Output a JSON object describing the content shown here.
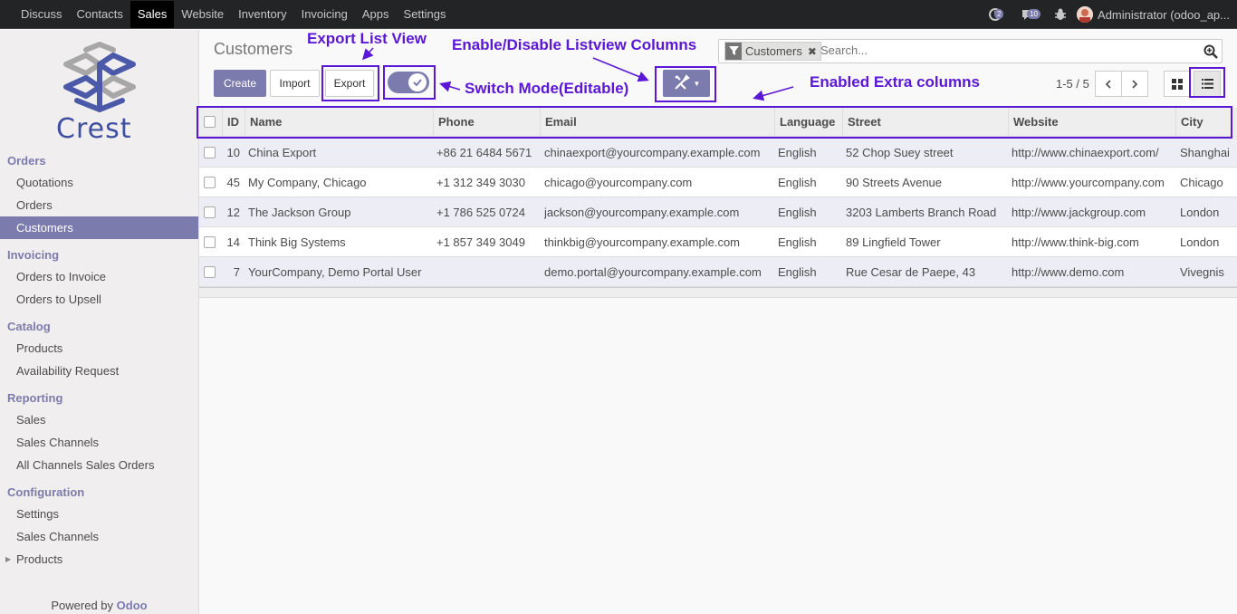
{
  "nav": {
    "items": [
      {
        "label": "Discuss",
        "active": false
      },
      {
        "label": "Contacts",
        "active": false
      },
      {
        "label": "Sales",
        "active": true
      },
      {
        "label": "Website",
        "active": false
      },
      {
        "label": "Inventory",
        "active": false
      },
      {
        "label": "Invoicing",
        "active": false
      },
      {
        "label": "Apps",
        "active": false
      },
      {
        "label": "Settings",
        "active": false
      }
    ],
    "activity_count": "2",
    "message_count": "10",
    "user": "Administrator (odoo_ap..."
  },
  "sidebar": {
    "logo_text": "Crest",
    "sections": [
      {
        "title": "Orders",
        "items": [
          "Quotations",
          "Orders",
          "Customers"
        ]
      },
      {
        "title": "Invoicing",
        "items": [
          "Orders to Invoice",
          "Orders to Upsell"
        ]
      },
      {
        "title": "Catalog",
        "items": [
          "Products",
          "Availability Request"
        ]
      },
      {
        "title": "Reporting",
        "items": [
          "Sales",
          "Sales Channels",
          "All Channels Sales Orders"
        ]
      },
      {
        "title": "Configuration",
        "items": [
          "Settings",
          "Sales Channels",
          "Products"
        ]
      }
    ],
    "active_item": "Customers",
    "powered_prefix": "Powered by",
    "powered_brand": "Odoo"
  },
  "control": {
    "breadcrumb": "Customers",
    "create_label": "Create",
    "import_label": "Import",
    "export_label": "Export",
    "search_facet": "Customers",
    "search_placeholder": "Search...",
    "pager": "1-5 / 5",
    "editable_mode_on": true
  },
  "annotations": {
    "export": "Export List View",
    "columns": "Enable/Disable Listview Columns",
    "switch": "Switch Mode(Editable)",
    "extra": "Enabled Extra columns"
  },
  "table": {
    "columns": [
      "ID",
      "Name",
      "Phone",
      "Email",
      "Language",
      "Street",
      "Website",
      "City"
    ],
    "rows": [
      {
        "id": "10",
        "name": "China Export",
        "phone": "+86 21 6484 5671",
        "email": "chinaexport@yourcompany.example.com",
        "language": "English",
        "street": "52 Chop Suey street",
        "website": "http://www.chinaexport.com/",
        "city": "Shanghai"
      },
      {
        "id": "45",
        "name": "My Company, Chicago",
        "phone": "+1 312 349 3030",
        "email": "chicago@yourcompany.com",
        "language": "English",
        "street": "90 Streets Avenue",
        "website": "http://www.yourcompany.com",
        "city": "Chicago"
      },
      {
        "id": "12",
        "name": "The Jackson Group",
        "phone": "+1 786 525 0724",
        "email": "jackson@yourcompany.example.com",
        "language": "English",
        "street": "3203 Lamberts Branch Road",
        "website": "http://www.jackgroup.com",
        "city": "London"
      },
      {
        "id": "14",
        "name": "Think Big Systems",
        "phone": "+1 857 349 3049",
        "email": "thinkbig@yourcompany.example.com",
        "language": "English",
        "street": "89 Lingfield Tower",
        "website": "http://www.think-big.com",
        "city": "London"
      },
      {
        "id": "7",
        "name": "YourCompany, Demo Portal User",
        "phone": "",
        "email": "demo.portal@yourcompany.example.com",
        "language": "English",
        "street": "Rue Cesar de Paepe, 43",
        "website": "http://www.demo.com",
        "city": "Vivegnis"
      }
    ]
  },
  "colors": {
    "accent": "#7c7bad",
    "annotation": "#5b17d6",
    "navbar": "#222426"
  }
}
